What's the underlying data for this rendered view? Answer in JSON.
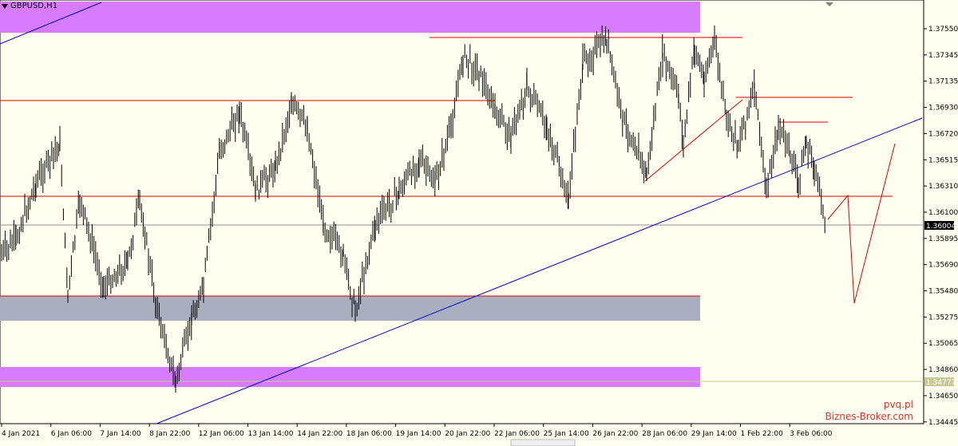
{
  "window": {
    "symbol": "GBPUSD,H1"
  },
  "price_axis": {
    "ticks": [
      "1.37550",
      "1.37345",
      "1.37135",
      "1.36930",
      "1.36720",
      "1.36515",
      "1.36310",
      "1.36100",
      "1.35895",
      "1.35690",
      "1.35480",
      "1.35275",
      "1.35065",
      "1.34860",
      "1.34650",
      "1.34445"
    ],
    "current_price": "1.36004",
    "level_label": "1.34777"
  },
  "time_axis": {
    "labels": [
      "4 Jan 2021",
      "6 Jan 06:00",
      "7 Jan 14:00",
      "8 Jan 22:00",
      "12 Jan 06:00",
      "13 Jan 14:00",
      "14 Jan 22:00",
      "18 Jan 06:00",
      "19 Jan 14:00",
      "20 Jan 22:00",
      "22 Jan 06:00",
      "25 Jan 14:00",
      "26 Jan 22:00",
      "28 Jan 06:00",
      "29 Jan 14:00",
      "1 Feb 22:00",
      "3 Feb 06:00"
    ]
  },
  "watermark": {
    "line1": "pvq.pl",
    "line2": "Biznes-Broker.com"
  },
  "colors": {
    "background": "#fffff0",
    "candle": "#000000",
    "zone_magenta": "#d87cff",
    "zone_gray": "#a9afbf",
    "trend_blue": "#0000cc",
    "level_red": "#dd0000",
    "dotted_level": "#c8c896"
  }
}
